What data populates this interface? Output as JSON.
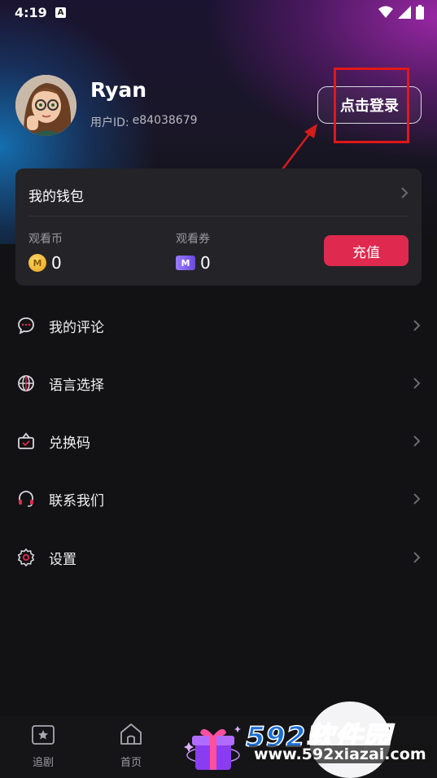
{
  "status_bar": {
    "time": "4:19",
    "notification_badge": "A"
  },
  "profile": {
    "username": "Ryan",
    "user_id_label": "用户ID:",
    "user_id_value": "e84038679",
    "login_label": "点击登录"
  },
  "wallet": {
    "title": "我的钱包",
    "coins_label": "观看币",
    "coins_value": "0",
    "coin_icon_letter": "M",
    "tickets_label": "观看券",
    "tickets_value": "0",
    "ticket_icon_letter": "M",
    "recharge_label": "充值"
  },
  "menu": {
    "items": [
      {
        "label": "我的评论",
        "icon": "comment-icon"
      },
      {
        "label": "语言选择",
        "icon": "globe-icon"
      },
      {
        "label": "兑换码",
        "icon": "gift-box-icon"
      },
      {
        "label": "联系我们",
        "icon": "headset-icon"
      },
      {
        "label": "设置",
        "icon": "gear-icon"
      }
    ]
  },
  "bottom_nav": {
    "items": [
      {
        "label": "追剧",
        "icon": "bookmark-star-icon"
      },
      {
        "label": "首页",
        "icon": "home-icon"
      }
    ]
  },
  "watermark": {
    "title": "592软件园",
    "url": "www.592xiazai.com"
  },
  "colors": {
    "accent": "#e0294e",
    "highlight": "#e01818",
    "background": "#121214",
    "card": "#232328"
  }
}
